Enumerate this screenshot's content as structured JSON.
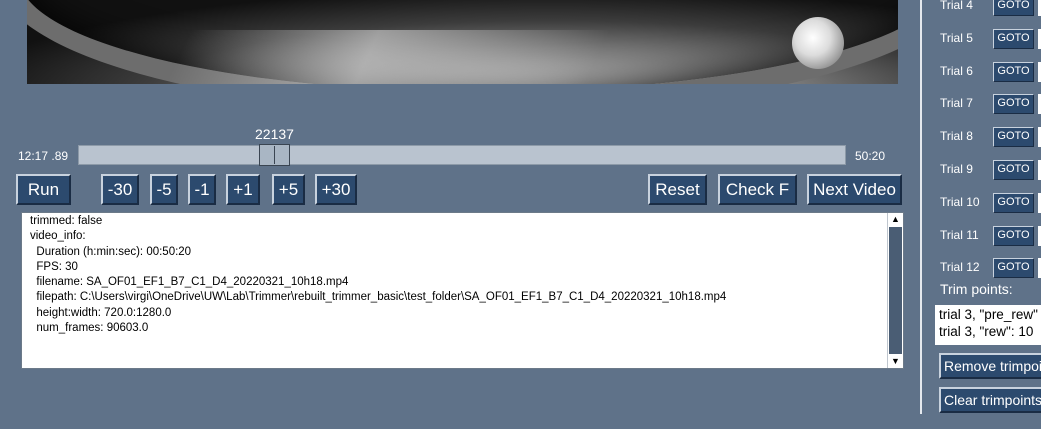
{
  "slider": {
    "frame": "22137",
    "start_time": "12:17 .89",
    "end_time": "50:20",
    "position_fraction": 0.243
  },
  "controls": {
    "run": "Run",
    "minus30": "-30",
    "minus5": "-5",
    "minus1": "-1",
    "plus1": "+1",
    "plus5": "+5",
    "plus30": "+30",
    "reset": "Reset",
    "check": "Check F",
    "next_video": "Next Video"
  },
  "log": {
    "text": "trimmed: false\nvideo_info:\n  Duration (h:min:sec): 00:50:20\n  FPS: 30\n  filename: SA_OF01_EF1_B7_C1_D4_20220321_10h18.mp4\n  filepath: C:\\Users\\virgi\\OneDrive\\UW\\Lab\\Trimmer\\rebuilt_trimmer_basic\\test_folder\\SA_OF01_EF1_B7_C1_D4_20220321_10h18.mp4\n  height:width: 720.0:1280.0\n  num_frames: 90603.0"
  },
  "trials": [
    {
      "label": "Trial 4",
      "goto": "GOTO"
    },
    {
      "label": "Trial 5",
      "goto": "GOTO"
    },
    {
      "label": "Trial 6",
      "goto": "GOTO"
    },
    {
      "label": "Trial 7",
      "goto": "GOTO"
    },
    {
      "label": "Trial 8",
      "goto": "GOTO"
    },
    {
      "label": "Trial 9",
      "goto": "GOTO"
    },
    {
      "label": "Trial 10",
      "goto": "GOTO"
    },
    {
      "label": "Trial 11",
      "goto": "GOTO"
    },
    {
      "label": "Trial 12",
      "goto": "GOTO"
    }
  ],
  "trim": {
    "label": "Trim points:",
    "lines": [
      "trial 3, \"pre_rew\"",
      "trial 3, \"rew\": 10"
    ],
    "remove_button": "Remove trimpoint",
    "clear_button": "Clear trimpoints"
  }
}
